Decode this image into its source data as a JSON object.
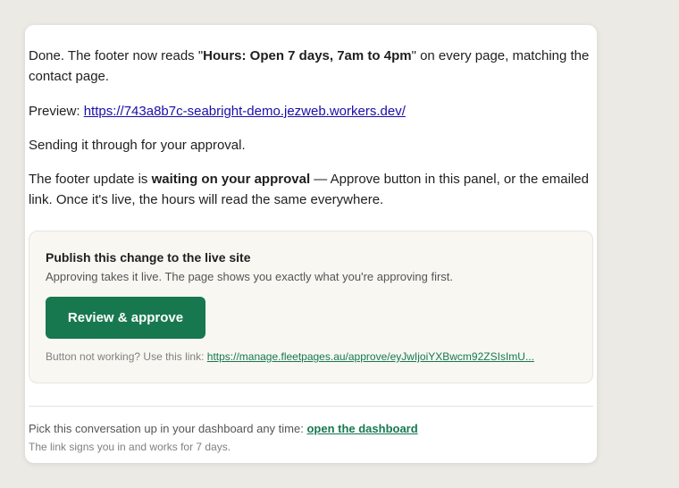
{
  "message": {
    "p1_prefix": "Done. The footer now reads \"",
    "p1_bold": "Hours: Open 7 days, 7am to 4pm",
    "p1_suffix": "\" on every page, matching the contact page.",
    "preview_label": "Preview: ",
    "preview_url": "https://743a8b7c-seabright-demo.jezweb.workers.dev/",
    "p3": "Sending it through for your approval.",
    "p4_prefix": "The footer update is ",
    "p4_bold": "waiting on your approval",
    "p4_suffix": " — Approve button in this panel, or the emailed link. Once it's live, the hours will read the same everywhere."
  },
  "approval_panel": {
    "title": "Publish this change to the live site",
    "subtitle": "Approving takes it live. The page shows you exactly what you're approving first.",
    "button_label": "Review & approve",
    "fallback_prefix": "Button not working? Use this link: ",
    "fallback_link": "https://manage.fleetpages.au/approve/eyJwIjoiYXBwcm92ZSIsImU..."
  },
  "footer": {
    "line1_prefix": "Pick this conversation up in your dashboard any time: ",
    "dashboard_link": "open the dashboard",
    "line2": "The link signs you in and works for 7 days."
  },
  "colors": {
    "accent": "#17784f",
    "page_bg": "#ebeae4",
    "panel_bg": "#f8f7f2"
  }
}
